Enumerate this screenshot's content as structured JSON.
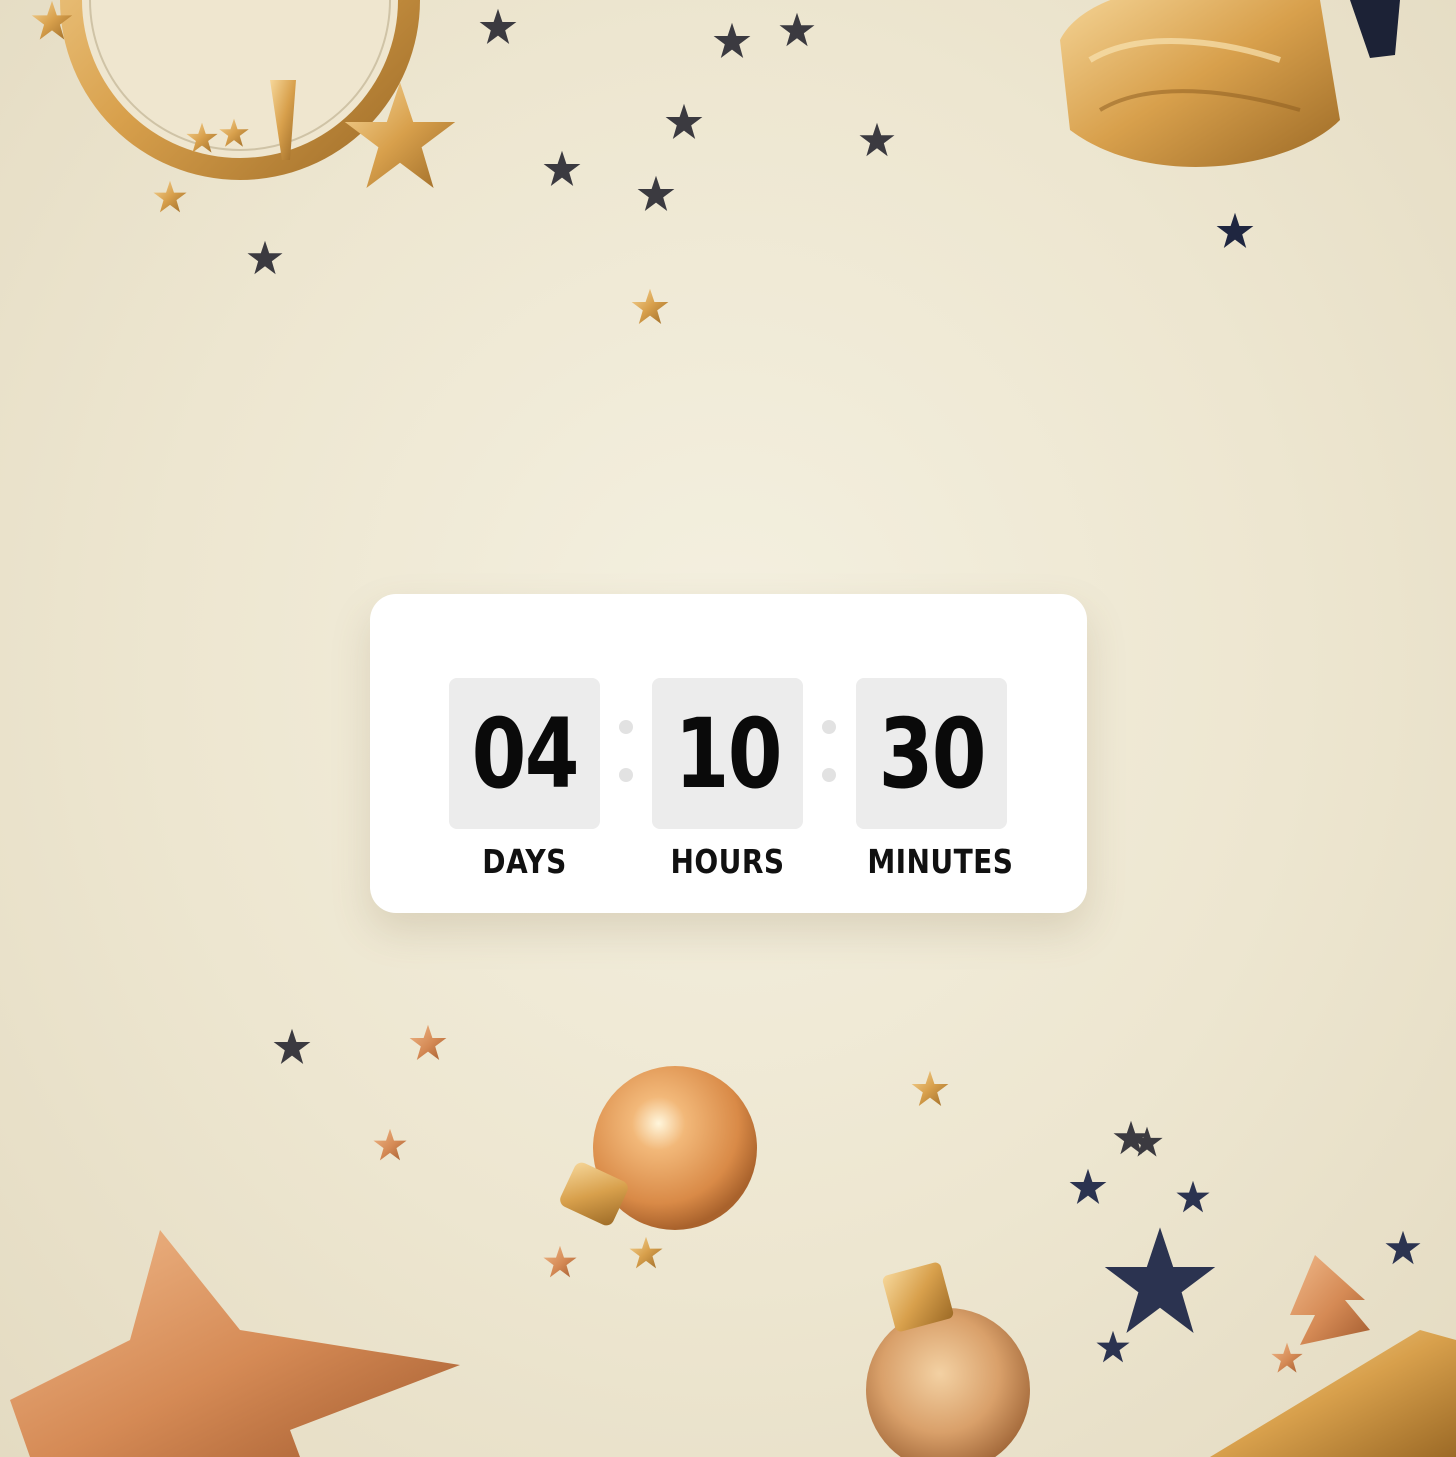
{
  "countdown": {
    "days": {
      "value": "04",
      "label": "DAYS"
    },
    "hours": {
      "value": "10",
      "label": "HOURS"
    },
    "minutes": {
      "value": "30",
      "label": "MINUTES"
    }
  },
  "colors": {
    "card_background": "#ffffff",
    "box_background": "#ececec",
    "digit_color": "#0a0a0a",
    "separator_color": "#e2e2e2"
  }
}
